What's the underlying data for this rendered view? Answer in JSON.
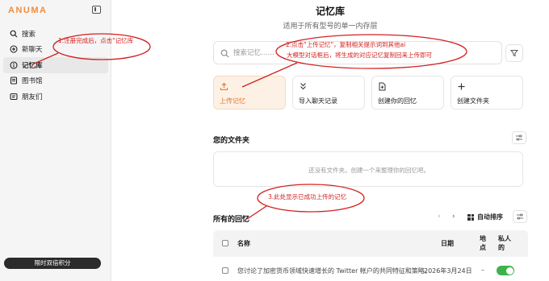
{
  "sidebar": {
    "logo": "ANUMA",
    "items": [
      {
        "label": "搜索",
        "icon": "search-icon"
      },
      {
        "label": "新聊天",
        "icon": "new-chat-icon"
      },
      {
        "label": "记忆库",
        "icon": "memory-icon",
        "active": true
      },
      {
        "label": "图书馆",
        "icon": "library-icon"
      },
      {
        "label": "朋友们",
        "icon": "friends-icon"
      }
    ],
    "promo_button": "限时双倍积分"
  },
  "main": {
    "title": "记忆库",
    "subtitle": "适用于所有型号的单一内存层",
    "search_placeholder": "搜索记忆……",
    "actions": [
      {
        "label": "上传记忆",
        "icon": "upload-icon",
        "highlight": true
      },
      {
        "label": "导入聊天记录",
        "icon": "import-icon"
      },
      {
        "label": "创建你的回忆",
        "icon": "create-memory-icon"
      },
      {
        "label": "创建文件夹",
        "icon": "plus-icon"
      }
    ],
    "folders": {
      "title": "您的文件夹",
      "empty_text": "还没有文件夹。创建一个来整理你的回忆吧。"
    },
    "memories": {
      "title": "所有的回忆",
      "auto_sort_label": "自动排序",
      "prev_glyph": "‹",
      "next_glyph": "›",
      "columns": {
        "name": "名称",
        "date": "日期",
        "location": "地点",
        "private": "私人的"
      },
      "rows": [
        {
          "name": "您讨论了加密货币领域快速增长的 Twitter 帐户的共同特征和策略。",
          "date": "2026年3月24日",
          "location": "–",
          "private": true
        }
      ]
    }
  },
  "annotations": [
    {
      "text": "1.注册完成后，点击\"记忆库"
    },
    {
      "text_line1": "2.点击\"上传记忆\"，复制相关提示词到其他ai",
      "text_line2": "大模型对话框后，将生成的对应记忆复制回来上传即可"
    },
    {
      "text": "3.此处显示已成功上传的记忆"
    }
  ],
  "colors": {
    "accent": "#f28c3c",
    "annotation": "#d32020",
    "toggle_on": "#3ab44a"
  }
}
